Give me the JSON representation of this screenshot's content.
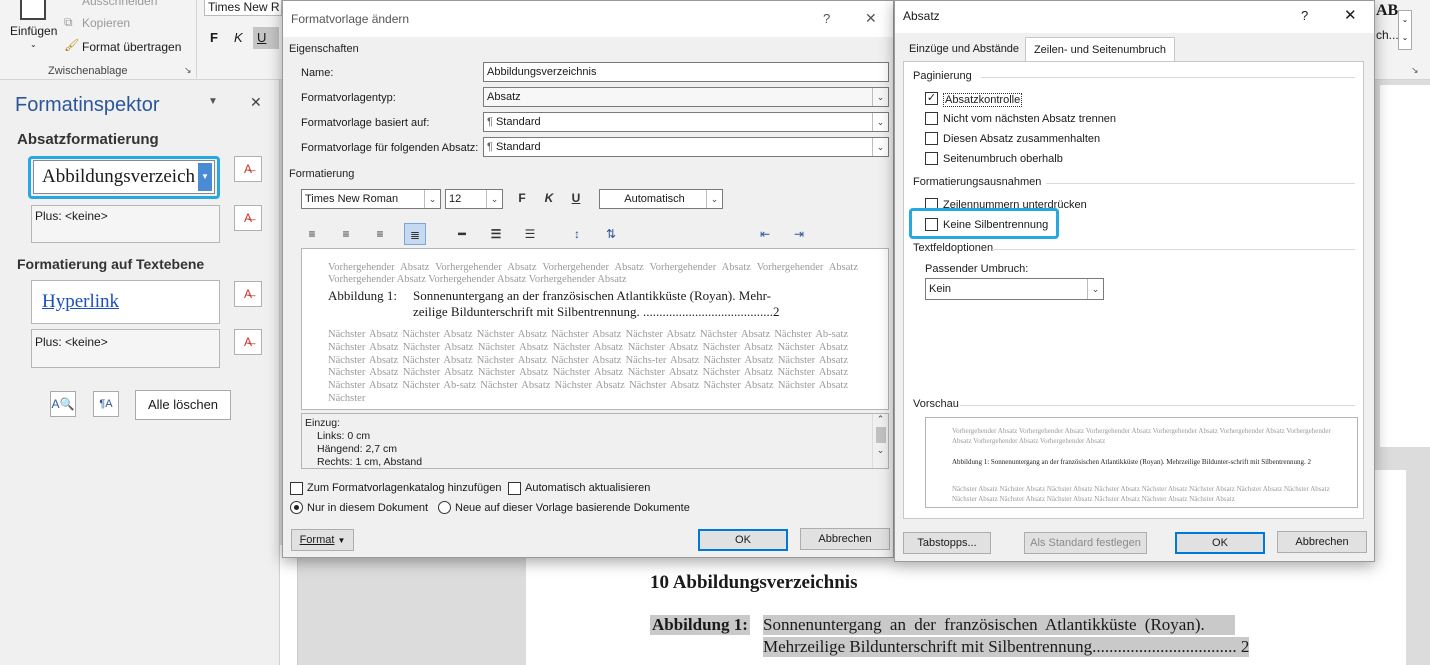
{
  "ribbon": {
    "paste_label": "Einfügen",
    "cut_label": "Ausschneiden",
    "copy_label": "Kopieren",
    "format_painter_label": "Format übertragen",
    "clipboard_group": "Zwischenablage",
    "font_name": "Times New R",
    "bold": "F",
    "italic": "K",
    "underline": "U",
    "right_bold": "AB",
    "right_dropdown": "ch..."
  },
  "inspector": {
    "title": "Formatinspektor",
    "paragraph_heading": "Absatzformatierung",
    "paragraph_style": "Abbildungsverzeich",
    "paragraph_plus": "Plus: <keine>",
    "text_heading": "Formatierung auf Textebene",
    "text_style": "Hyperlink",
    "text_plus": "Plus: <keine>",
    "clear_all": "Alle löschen"
  },
  "style_dialog": {
    "title": "Formatvorlage ändern",
    "help": "?",
    "close": "✕",
    "properties_label": "Eigenschaften",
    "name_label": "Name:",
    "name_value": "Abbildungsverzeichnis",
    "type_label": "Formatvorlagentyp:",
    "type_value": "Absatz",
    "based_label": "Formatvorlage basiert auf:",
    "based_value": "Standard",
    "next_label": "Formatvorlage für folgenden Absatz:",
    "next_value": "Standard",
    "formatting_label": "Formatierung",
    "font": "Times New Roman",
    "size": "12",
    "bold": "F",
    "italic": "K",
    "underline": "U",
    "color": "Automatisch",
    "preview_prev": "Vorhergehender Absatz Vorhergehender Absatz Vorhergehender Absatz Vorhergehender Absatz Vorhergehender Absatz Vorhergehender Absatz Vorhergehender Absatz Vorhergehender Absatz",
    "preview_main_label": "Abbildung 1:",
    "preview_main_line1": "Sonnenuntergang an der französischen Atlantikküste (Royan). Mehr-",
    "preview_main_line2": "zeilige Bildunterschrift mit Silbentrennung. ........................................2",
    "preview_next": "Nächster Absatz Nächster Absatz Nächster Absatz Nächster Absatz Nächster Absatz Nächster Absatz Nächster Ab-satz Nächster Absatz Nächster Absatz Nächster Absatz Nächster Absatz Nächster Absatz Nächster Absatz Nächster Absatz Nächster Absatz Nächster Absatz Nächster Absatz Nächster Absatz Nächs-ter Absatz Nächster Absatz Nächster Absatz Nächster Absatz Nächster Absatz Nächster Absatz Nächster Absatz Nächster Absatz Nächster Absatz Nächster Absatz Nächster Absatz Nächster Ab-satz Nächster Absatz Nächster Absatz Nächster Absatz Nächster Absatz Nächster Absatz Nächster",
    "desc_lines": [
      "Einzug:",
      "Links:  0 cm",
      "Hängend:  2,7 cm",
      "Rechts:  1 cm, Abstand"
    ],
    "add_gallery": "Zum Formatvorlagenkatalog hinzufügen",
    "auto_update": "Automatisch aktualisieren",
    "only_doc": "Nur in diesem Dokument",
    "new_docs": "Neue auf dieser Vorlage basierende Dokumente",
    "format_btn": "Format",
    "ok": "OK",
    "cancel": "Abbrechen"
  },
  "para_dialog": {
    "title": "Absatz",
    "help": "?",
    "close": "✕",
    "tab1": "Einzüge und Abstände",
    "tab2": "Zeilen- und Seitenumbruch",
    "pagination": "Paginierung",
    "cb_widow": "Absatzkontrolle",
    "cb_keepnext": "Nicht vom nächsten Absatz trennen",
    "cb_keeptogether": "Diesen Absatz zusammenhalten",
    "cb_pagebreak": "Seitenumbruch oberhalb",
    "exceptions": "Formatierungsausnahmen",
    "cb_linenum": "Zeilennummern unterdrücken",
    "cb_hyphen": "Keine Silbentrennung",
    "textbox": "Textfeldoptionen",
    "tight_wrap": "Passender Umbruch:",
    "tight_value": "Kein",
    "preview_label": "Vorschau",
    "prev_prev": "Vorhergehender Absatz Vorhergehender Absatz Vorhergehender Absatz Vorhergehender Absatz Vorhergehender Absatz Vorhergehender Absatz Vorhergehender Absatz Vorhergehender Absatz",
    "prev_main": "Abbildung 1:    Sonnenuntergang an der französischen Atlantikküste (Royan). Mehrzeilige Bildunter-schrift mit Silbentrennung.  2",
    "prev_next": "Nächster Absatz Nächster Absatz Nächster Absatz Nächster Absatz Nächster Absatz Nächster Absatz Nächster Absatz Nächster Absatz Nächster Absatz Nächster Absatz Nächster Absatz Nächster Absatz Nächster Absatz Nächster Absatz",
    "tabs_btn": "Tabstopps...",
    "default_btn": "Als Standard festlegen",
    "ok": "OK",
    "cancel": "Abbrechen"
  },
  "document": {
    "heading": "10  Abbildungsverzeichnis",
    "entry_label": "Abbildung 1:",
    "entry_line1": "Sonnenuntergang an der französischen Atlantikküste (Royan).",
    "entry_line2": "Mehrzeilige Bildunterschrift mit Silbentrennung.................................. 2"
  }
}
